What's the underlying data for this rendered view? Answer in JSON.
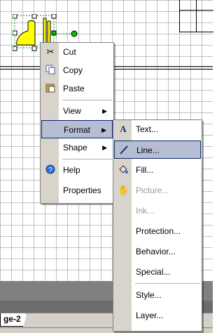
{
  "context_menu": {
    "items": [
      {
        "label": "Cut",
        "icon": "scissors-icon"
      },
      {
        "label": "Copy",
        "icon": "copy-icon"
      },
      {
        "label": "Paste",
        "icon": "paste-icon"
      },
      {
        "label": "View",
        "submenu": true
      },
      {
        "label": "Format",
        "submenu": true,
        "selected": true
      },
      {
        "label": "Shape",
        "submenu": true
      },
      {
        "label": "Help",
        "icon": "help-icon"
      },
      {
        "label": "Properties"
      }
    ]
  },
  "format_submenu": {
    "items": [
      {
        "label": "Text...",
        "icon": "text-a-icon"
      },
      {
        "label": "Line...",
        "icon": "line-pen-icon",
        "selected": true
      },
      {
        "label": "Fill...",
        "icon": "fill-bucket-icon"
      },
      {
        "label": "Picture...",
        "icon": "picture-hand-icon",
        "disabled": true
      },
      {
        "label": "Ink...",
        "disabled": true
      },
      {
        "label": "Protection..."
      },
      {
        "label": "Behavior..."
      },
      {
        "label": "Special..."
      },
      {
        "label": "Style..."
      },
      {
        "label": "Layer..."
      }
    ]
  },
  "page_tab": {
    "label": "ge-2"
  },
  "colors": {
    "menu_highlight": "#b6bdd2",
    "menu_strip": "#d8d4cc",
    "shape_fill": "#ffff00",
    "handle_green": "#00c000"
  }
}
